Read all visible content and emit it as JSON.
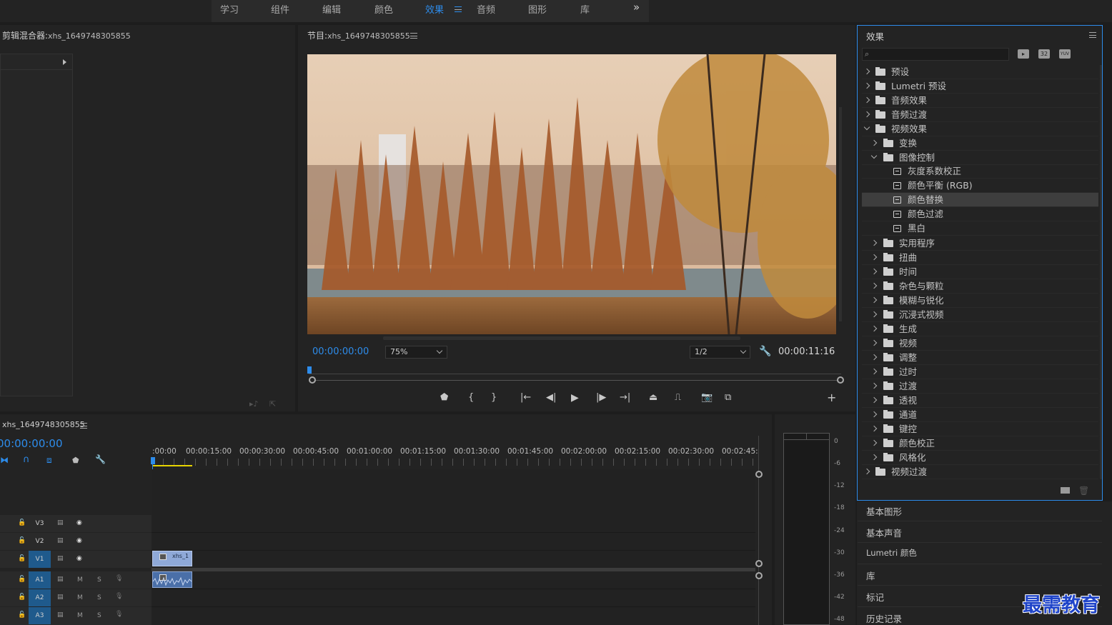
{
  "workspace_tabs": [
    "学习",
    "组件",
    "编辑",
    "颜色",
    "效果",
    "音频",
    "图形",
    "库"
  ],
  "workspace_active": "效果",
  "workspace_overflow": "»",
  "clip_mixer": {
    "title": "剪辑混合器:",
    "name": "xhs_1649748305855"
  },
  "program_monitor": {
    "title": "节目:",
    "name": "xhs_1649748305855",
    "current_timecode": "00:00:00:00",
    "zoom": "75%",
    "resolution": "1/2",
    "duration": "00:00:11:16",
    "add_button": "+"
  },
  "effects_panel": {
    "title": "效果",
    "badges": [
      "32",
      "YUV"
    ],
    "tree": [
      {
        "label": "预设"
      },
      {
        "label": "Lumetri 预设"
      },
      {
        "label": "音频效果"
      },
      {
        "label": "音频过渡"
      },
      {
        "label": "视频效果"
      },
      {
        "label": "变换"
      },
      {
        "label": "图像控制"
      },
      {
        "label": "灰度系数校正"
      },
      {
        "label": "颜色平衡 (RGB)"
      },
      {
        "label": "颜色替换"
      },
      {
        "label": "颜色过滤"
      },
      {
        "label": "黑白"
      },
      {
        "label": "实用程序"
      },
      {
        "label": "扭曲"
      },
      {
        "label": "时间"
      },
      {
        "label": "杂色与颗粒"
      },
      {
        "label": "模糊与锐化"
      },
      {
        "label": "沉浸式视频"
      },
      {
        "label": "生成"
      },
      {
        "label": "视频"
      },
      {
        "label": "调整"
      },
      {
        "label": "过时"
      },
      {
        "label": "过渡"
      },
      {
        "label": "透视"
      },
      {
        "label": "通道"
      },
      {
        "label": "键控"
      },
      {
        "label": "颜色校正"
      },
      {
        "label": "风格化"
      },
      {
        "label": "视频过渡"
      }
    ]
  },
  "side_panels": [
    "基本图形",
    "基本声音",
    "Lumetri 颜色",
    "库",
    "标记",
    "历史记录"
  ],
  "timeline": {
    "sequence_name": "xhs_1649748305855",
    "timecode": "00:00:00:00",
    "ruler": [
      ":00:00",
      "00:00:15:00",
      "00:00:30:00",
      "00:00:45:00",
      "00:01:00:00",
      "00:01:15:00",
      "00:01:30:00",
      "00:01:45:00",
      "00:02:00:00",
      "00:02:15:00",
      "00:02:30:00",
      "00:02:45:"
    ],
    "video_tracks": [
      "V3",
      "V2",
      "V1"
    ],
    "audio_tracks": [
      "A1",
      "A2",
      "A3"
    ],
    "mute_label": "M",
    "solo_label": "S",
    "clip_name": "xhs_1"
  },
  "audio_meter": {
    "scale": [
      "0",
      "-6",
      "-12",
      "-18",
      "-24",
      "-30",
      "-36",
      "-42",
      "-48"
    ]
  },
  "watermark": "最需教育"
}
